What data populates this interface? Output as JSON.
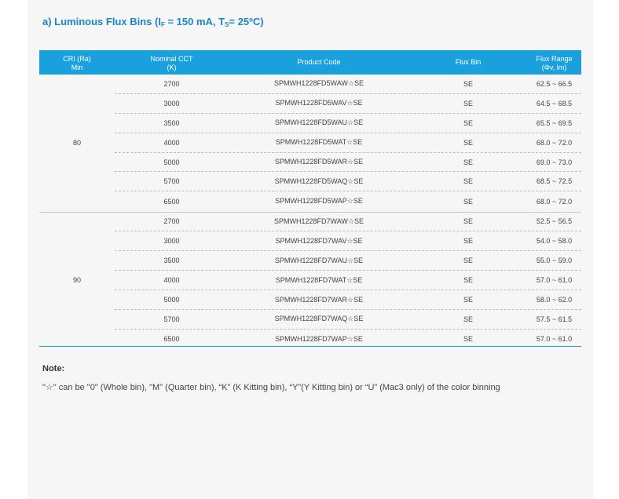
{
  "heading": {
    "prefix": "a)  Luminous Flux Bins (I",
    "sub1": "F",
    "mid": " = 150 mA, T",
    "sub2": "S",
    "suffix": "= 25ºC)"
  },
  "table": {
    "headers": {
      "cri_l1": "CRI (Ra)",
      "cri_l2": "Min",
      "cct_l1": "Nominal CCT",
      "cct_l2": "(K)",
      "code": "Product Code",
      "bin": "Flux Bin",
      "flux_l1": "Flux Range",
      "flux_l2": "(Φv, lm)"
    },
    "groups": [
      {
        "cri": "80",
        "rows": [
          {
            "cct": "2700",
            "code": "SPMWH1228FD5WAW☆SE",
            "bin": "SE",
            "flux": "62.5 ~ 66.5"
          },
          {
            "cct": "3000",
            "code": "SPMWH1228FD5WAV☆SE",
            "bin": "SE",
            "flux": "64.5 ~ 68.5"
          },
          {
            "cct": "3500",
            "code": "SPMWH1228FD5WAU☆SE",
            "bin": "SE",
            "flux": "65.5 ~ 69.5"
          },
          {
            "cct": "4000",
            "code": "SPMWH1228FD5WAT☆SE",
            "bin": "SE",
            "flux": "68.0 ~ 72.0"
          },
          {
            "cct": "5000",
            "code": "SPMWH1228FD5WAR☆SE",
            "bin": "SE",
            "flux": "69.0 ~ 73.0"
          },
          {
            "cct": "5700",
            "code": "SPMWH1228FD5WAQ☆SE",
            "bin": "SE",
            "flux": "68.5 ~ 72.5"
          },
          {
            "cct": "6500",
            "code": "SPMWH1228FD5WAP☆SE",
            "bin": "SE",
            "flux": "68.0 ~ 72.0"
          }
        ]
      },
      {
        "cri": "90",
        "rows": [
          {
            "cct": "2700",
            "code": "SPMWH1228FD7WAW☆SE",
            "bin": "SE",
            "flux": "52.5 ~ 56.5"
          },
          {
            "cct": "3000",
            "code": "SPMWH1228FD7WAV☆SE",
            "bin": "SE",
            "flux": "54.0 ~ 58.0"
          },
          {
            "cct": "3500",
            "code": "SPMWH1228FD7WAU☆SE",
            "bin": "SE",
            "flux": "55.0 ~ 59.0"
          },
          {
            "cct": "4000",
            "code": "SPMWH1228FD7WAT☆SE",
            "bin": "SE",
            "flux": "57.0 ~ 61.0"
          },
          {
            "cct": "5000",
            "code": "SPMWH1228FD7WAR☆SE",
            "bin": "SE",
            "flux": "58.0 ~ 62.0"
          },
          {
            "cct": "5700",
            "code": "SPMWH1228FD7WAQ☆SE",
            "bin": "SE",
            "flux": "57.5 ~ 61.5"
          },
          {
            "cct": "6500",
            "code": "SPMWH1228FD7WAP☆SE",
            "bin": "SE",
            "flux": "57.0 ~ 61.0"
          }
        ]
      }
    ]
  },
  "note": {
    "title": "Note:",
    "text": "\"☆\" can be \"0\" (Whole bin), \"M\" (Quarter bin), “K” (K Kitting bin), “Y”(Y Kitting bin) or “U” (Mac3 only) of the color binning"
  },
  "colors": {
    "accent": "#1aa0dc",
    "heading": "#1a86c4"
  }
}
